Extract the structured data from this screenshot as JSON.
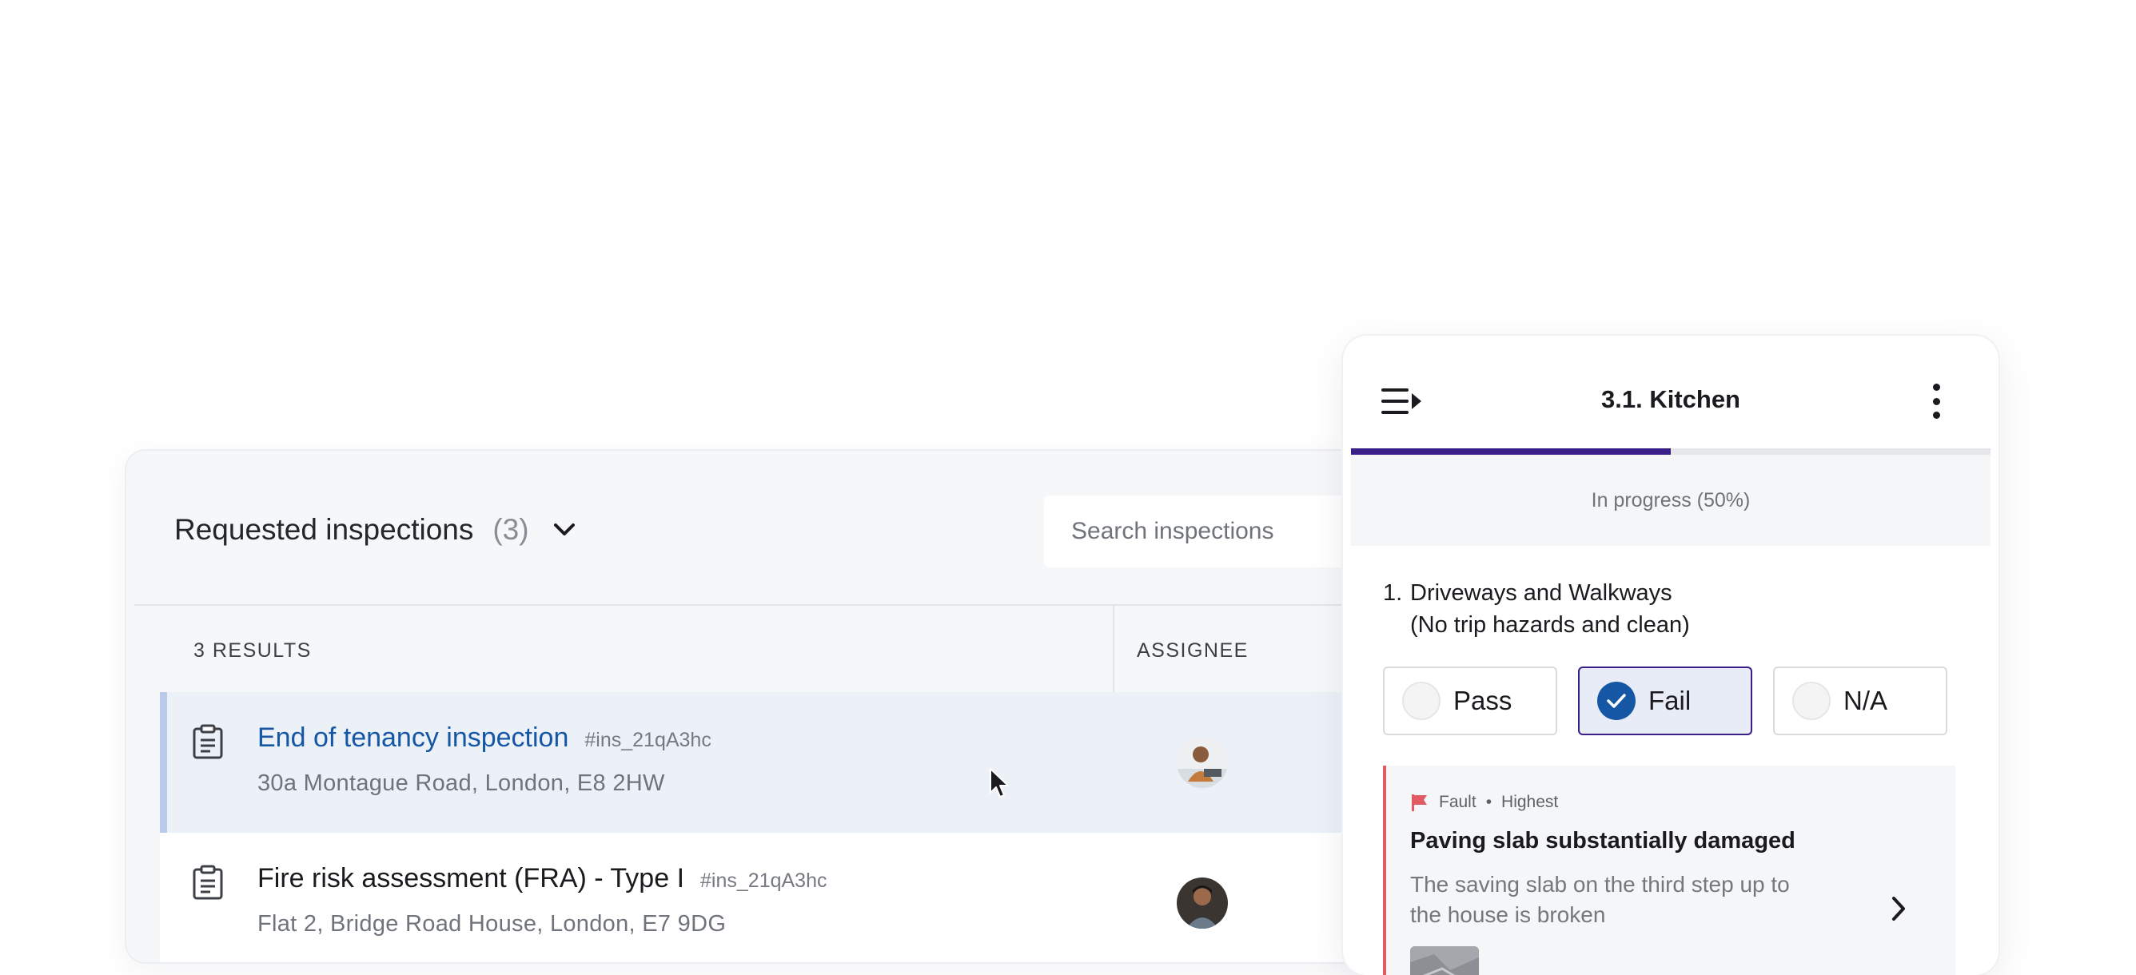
{
  "list": {
    "title": "Requested inspections",
    "count": "(3)",
    "search_placeholder": "Search inspections",
    "results_label": "3 RESULTS",
    "assignee_header": "ASSIGNEE",
    "rows": [
      {
        "title": "End of tenancy inspection",
        "id": "#ins_21qA3hc",
        "address": "30a Montague Road, London, E8 2HW",
        "selected": true
      },
      {
        "title": "Fire risk assessment (FRA) - Type I",
        "id": "#ins_21qA3hc",
        "address": "Flat 2, Bridge Road House, London, E7 9DG",
        "selected": false
      }
    ]
  },
  "panel": {
    "title": "3.1. Kitchen",
    "progress_text": "In progress (50%)",
    "progress_value": 0.5,
    "progress_color": "#3a1f88",
    "question": {
      "number": "1.",
      "text": "Driveways and Walkways",
      "subtext": "(No trip hazards and clean)"
    },
    "options": [
      {
        "label": "Pass",
        "selected": false
      },
      {
        "label": "Fail",
        "selected": true
      },
      {
        "label": "N/A",
        "selected": false
      }
    ],
    "fault": {
      "type": "Fault",
      "separator": "•",
      "priority": "Highest",
      "title": "Paving slab substantially damaged",
      "description": "The saving slab on the third step up to the house is broken",
      "accent_color": "#e15b64"
    }
  },
  "colors": {
    "link_blue": "#1557a5",
    "brand_purple": "#3a1f88"
  }
}
